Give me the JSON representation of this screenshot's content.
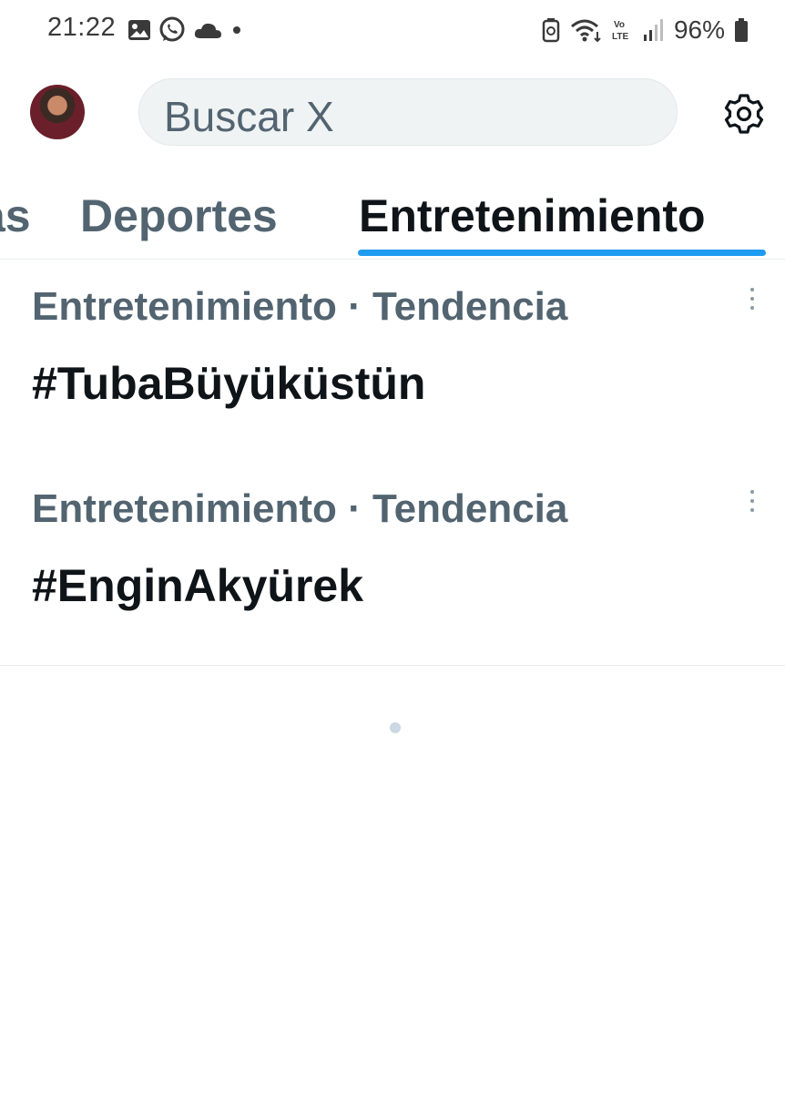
{
  "status_bar": {
    "time": "21:22",
    "battery": "96%",
    "icons_left": [
      "gallery-icon",
      "whatsapp-icon",
      "cloud-icon",
      "dot-icon"
    ],
    "icons_right": [
      "battery-saver-icon",
      "wifi-icon",
      "volte-icon",
      "signal-icon",
      "battery-icon"
    ]
  },
  "header": {
    "avatar_icon": "avatar",
    "search_placeholder": "Buscar X",
    "settings_icon": "gear-icon"
  },
  "tabs": {
    "items": [
      {
        "label": "as",
        "active": false
      },
      {
        "label": "Deportes",
        "active": false
      },
      {
        "label": "Entretenimiento",
        "active": true
      }
    ],
    "accent_color": "#1d9bf0"
  },
  "trends": [
    {
      "meta": "Entretenimiento · Tendencia",
      "title": "#TubaBüyüküstün"
    },
    {
      "meta": "Entretenimiento · Tendencia",
      "title": "#EnginAkyürek"
    }
  ],
  "colors": {
    "text_primary": "#0f1419",
    "text_secondary": "#536471",
    "search_bg": "#eff3f4"
  }
}
